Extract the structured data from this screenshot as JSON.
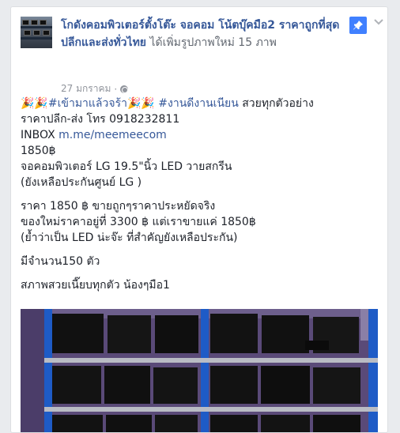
{
  "post": {
    "page_name": "โกดังคอมพิวเตอร์ตั้งโต๊ะ จอคอม โน้ตบุ๊คมือ2 ราคาถูกที่สุด ปลีกและส่งทั่วไทย",
    "action_text": "ได้เพิ่มรูปภาพใหม่ 15 ภาพ",
    "timestamp": "27 มกราคม",
    "separator": "·",
    "pin_icon": "pushpin-icon",
    "menu_icon": "chevron-down-icon"
  },
  "content": {
    "line1_emoji": "🎉🎉",
    "line1_tag1": "#เข้ามาแล้วจร้า",
    "line1_emoji2": "🎉🎉",
    "line1_tag2": "#งานดีงานเนียน",
    "line1_rest": " สวยทุกตัวอย่าง",
    "line2": "ราคาปลีก-ส่ง โทร 0918232811",
    "line3_prefix": "INBOX ",
    "line3_link": "m.me/meemeecom",
    "line4": "1850฿",
    "line5": "จอคอมพิวเตอร์ LG 19.5\"นิ้ว LED วายสกรีน",
    "line6": "(ยังเหลือประกันศูนย์ LG )",
    "line7": "ราคา 1850 ฿ ขายถูกๆราคาประหยัดจริง",
    "line8": "ของใหม่ราคาอยู่ที่ 3300 ฿ แต่เราขายแค่ 1850฿",
    "line9": "(ย้ำว่าเป็น LED น่ะจ๊ะ ที่สำคัญยังเหลือประกัน)",
    "line10": "มีจำนวน150 ตัว",
    "line11": "สภาพสวยเนี๊ยบทุกตัว น้องๆมือ1"
  },
  "colors": {
    "link": "#365899",
    "meta": "#90949c",
    "pin_bg": "#4080ff",
    "rack": "#1e5bc6"
  }
}
